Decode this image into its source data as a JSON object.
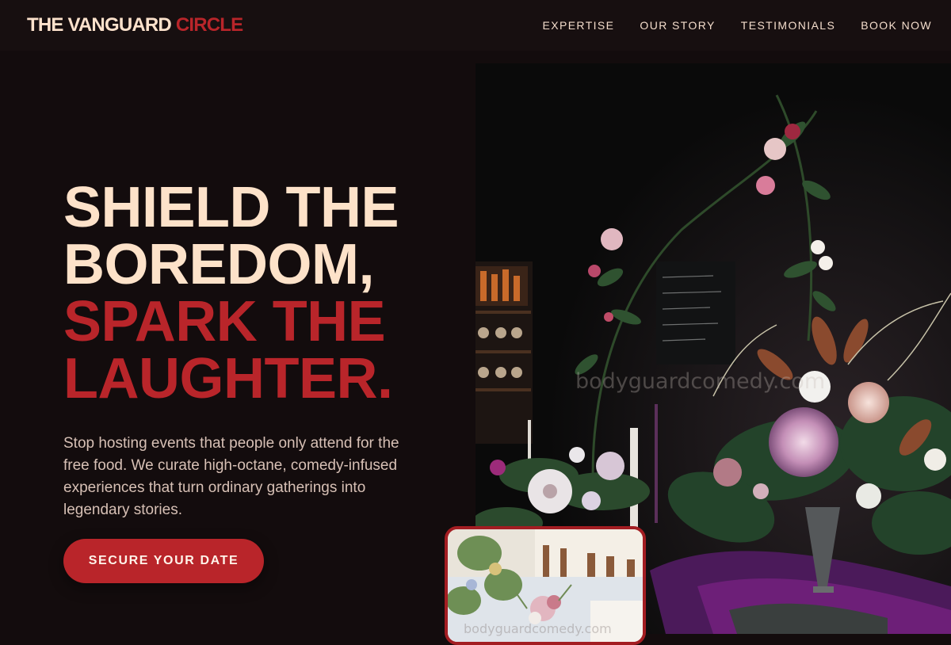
{
  "brand": {
    "name_main": "THE VANGUARD ",
    "name_accent": "CIRCLE"
  },
  "nav": {
    "links": [
      "EXPERTISE",
      "OUR STORY",
      "TESTIMONIALS",
      "BOOK NOW"
    ]
  },
  "hero": {
    "headline_lines": [
      "SHIELD THE",
      "BOREDOM,",
      "SPARK THE",
      "LAUGHTER."
    ],
    "description": "Stop hosting events that people only attend for the free food. We curate high-octane, comedy-infused experiences that turn ordinary gatherings into legendary stories.",
    "cta_label": "SECURE YOUR DATE"
  },
  "images": {
    "main_watermark": "bodyguardcomedy.com",
    "inset_watermark": "bodyguardcomedy.com"
  },
  "colors": {
    "background": "#130c0d",
    "accent": "#b9252a",
    "headline_light": "#fde2c9",
    "body_text": "#d7c0b5"
  }
}
